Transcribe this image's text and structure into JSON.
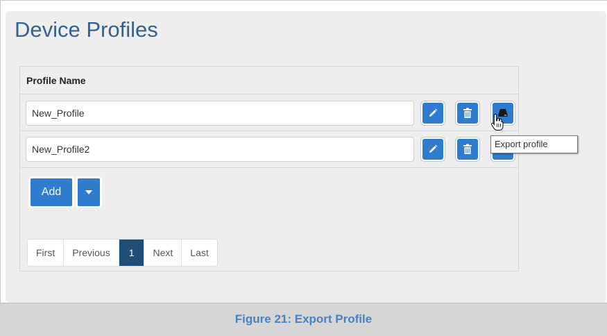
{
  "page": {
    "title": "Device Profiles"
  },
  "table": {
    "column_header": "Profile Name",
    "rows": [
      {
        "name": "New_Profile"
      },
      {
        "name": "New_Profile2"
      }
    ],
    "row_actions": [
      "edit-icon",
      "trash-icon",
      "export-icon"
    ]
  },
  "add_button": {
    "label": "Add",
    "menu_icon": "caret-down-icon"
  },
  "pagination": {
    "items": [
      "First",
      "Previous",
      "1",
      "Next",
      "Last"
    ],
    "current_page": "1"
  },
  "tooltip": {
    "text": "Export profile"
  },
  "caption": {
    "text": "Figure 21: Export Profile"
  },
  "colors": {
    "title": "#35618c",
    "button": "#2f7bd0",
    "active_page": "#1f4e79",
    "panel": "#eeeeee",
    "caption_text": "#4a7fc0",
    "caption_bg": "#d6d6d6"
  }
}
